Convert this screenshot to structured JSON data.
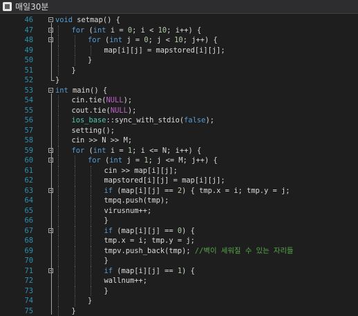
{
  "window": {
    "title": "매일30분",
    "icon": "app-icon"
  },
  "editor": {
    "lines": [
      {
        "n": "46",
        "fold": true,
        "indent": 0,
        "tokens": [
          {
            "t": "void",
            "c": "kw"
          },
          {
            "t": " setmap() {"
          }
        ]
      },
      {
        "n": "47",
        "fold": true,
        "indent": 1,
        "tokens": [
          {
            "t": "for",
            "c": "kw"
          },
          {
            "t": " ("
          },
          {
            "t": "int",
            "c": "kw"
          },
          {
            "t": " i = "
          },
          {
            "t": "0",
            "c": "num"
          },
          {
            "t": "; i < "
          },
          {
            "t": "10",
            "c": "num"
          },
          {
            "t": "; i++) {"
          }
        ]
      },
      {
        "n": "48",
        "fold": true,
        "indent": 2,
        "tokens": [
          {
            "t": "for",
            "c": "kw"
          },
          {
            "t": " ("
          },
          {
            "t": "int",
            "c": "kw"
          },
          {
            "t": " j = "
          },
          {
            "t": "0",
            "c": "num"
          },
          {
            "t": "; j < "
          },
          {
            "t": "10",
            "c": "num"
          },
          {
            "t": "; j++) {"
          }
        ]
      },
      {
        "n": "49",
        "fold": false,
        "indent": 3,
        "tokens": [
          {
            "t": "map[i][j] = mapstored[i][j];"
          }
        ]
      },
      {
        "n": "50",
        "fold": false,
        "indent": 2,
        "tokens": [
          {
            "t": "}"
          }
        ]
      },
      {
        "n": "51",
        "fold": false,
        "indent": 1,
        "tokens": [
          {
            "t": "}"
          }
        ]
      },
      {
        "n": "52",
        "fold": false,
        "indent": 0,
        "tokens": [
          {
            "t": "}"
          }
        ]
      },
      {
        "n": "53",
        "fold": true,
        "indent": 0,
        "tokens": [
          {
            "t": "int",
            "c": "kw"
          },
          {
            "t": " main() {"
          }
        ]
      },
      {
        "n": "54",
        "fold": false,
        "indent": 1,
        "tokens": [
          {
            "t": "cin.tie("
          },
          {
            "t": "NULL",
            "c": "macro"
          },
          {
            "t": ");"
          }
        ]
      },
      {
        "n": "55",
        "fold": false,
        "indent": 1,
        "tokens": [
          {
            "t": "cout.tie("
          },
          {
            "t": "NULL",
            "c": "macro"
          },
          {
            "t": ");"
          }
        ]
      },
      {
        "n": "56",
        "fold": false,
        "indent": 1,
        "tokens": [
          {
            "t": "ios_base",
            "c": "type"
          },
          {
            "t": "::sync_with_stdio("
          },
          {
            "t": "false",
            "c": "kw"
          },
          {
            "t": ");"
          }
        ]
      },
      {
        "n": "57",
        "fold": false,
        "indent": 1,
        "tokens": [
          {
            "t": "setting();"
          }
        ]
      },
      {
        "n": "58",
        "fold": false,
        "indent": 1,
        "tokens": [
          {
            "t": "cin >> N >> M;"
          }
        ]
      },
      {
        "n": "59",
        "fold": true,
        "indent": 1,
        "tokens": [
          {
            "t": "for",
            "c": "kw"
          },
          {
            "t": " ("
          },
          {
            "t": "int",
            "c": "kw"
          },
          {
            "t": " i = "
          },
          {
            "t": "1",
            "c": "num"
          },
          {
            "t": "; i <= N; i++) {"
          }
        ]
      },
      {
        "n": "60",
        "fold": true,
        "indent": 2,
        "tokens": [
          {
            "t": "for",
            "c": "kw"
          },
          {
            "t": " ("
          },
          {
            "t": "int",
            "c": "kw"
          },
          {
            "t": " j = "
          },
          {
            "t": "1",
            "c": "num"
          },
          {
            "t": "; j <= M; j++) {"
          }
        ]
      },
      {
        "n": "61",
        "fold": false,
        "indent": 3,
        "tokens": [
          {
            "t": "cin >> map[i][j];"
          }
        ]
      },
      {
        "n": "62",
        "fold": false,
        "indent": 3,
        "tokens": [
          {
            "t": "mapstored[i][j] = map[i][j];"
          }
        ]
      },
      {
        "n": "63",
        "fold": true,
        "indent": 3,
        "tokens": [
          {
            "t": "if",
            "c": "kw"
          },
          {
            "t": " (map[i][j] == "
          },
          {
            "t": "2",
            "c": "num"
          },
          {
            "t": ") { tmp.x = i; tmp.y = j;"
          }
        ]
      },
      {
        "n": "64",
        "fold": false,
        "indent": 3,
        "tokens": [
          {
            "t": "tmpq.push(tmp);"
          }
        ]
      },
      {
        "n": "65",
        "fold": false,
        "indent": 3,
        "tokens": [
          {
            "t": "virusnum++;"
          }
        ]
      },
      {
        "n": "66",
        "fold": false,
        "indent": 3,
        "tokens": [
          {
            "t": "}"
          }
        ]
      },
      {
        "n": "67",
        "fold": true,
        "indent": 3,
        "tokens": [
          {
            "t": "if",
            "c": "kw"
          },
          {
            "t": " (map[i][j] == "
          },
          {
            "t": "0",
            "c": "num"
          },
          {
            "t": ") {"
          }
        ]
      },
      {
        "n": "68",
        "fold": false,
        "indent": 3,
        "tokens": [
          {
            "t": "tmp.x = i; tmp.y = j;"
          }
        ]
      },
      {
        "n": "69",
        "fold": false,
        "indent": 3,
        "tokens": [
          {
            "t": "tmpv.push_back(tmp); "
          },
          {
            "t": "//벽이 세워질 수 있는 자리들",
            "c": "cmt"
          }
        ]
      },
      {
        "n": "70",
        "fold": false,
        "indent": 3,
        "tokens": [
          {
            "t": "}"
          }
        ]
      },
      {
        "n": "71",
        "fold": true,
        "indent": 3,
        "tokens": [
          {
            "t": "if",
            "c": "kw"
          },
          {
            "t": " (map[i][j] == "
          },
          {
            "t": "1",
            "c": "num"
          },
          {
            "t": ") {"
          }
        ]
      },
      {
        "n": "72",
        "fold": false,
        "indent": 3,
        "tokens": [
          {
            "t": "wallnum++;"
          }
        ]
      },
      {
        "n": "73",
        "fold": false,
        "indent": 3,
        "tokens": [
          {
            "t": "}"
          }
        ]
      },
      {
        "n": "74",
        "fold": false,
        "indent": 2,
        "tokens": [
          {
            "t": "}"
          }
        ]
      },
      {
        "n": "75",
        "fold": false,
        "indent": 1,
        "tokens": [
          {
            "t": "}"
          }
        ]
      }
    ]
  },
  "colors": {
    "background": "#1e1e1e",
    "line_number": "#2b91af",
    "keyword": "#569cd6",
    "number": "#b5cea8",
    "macro": "#bd63c5",
    "type": "#4ec9b0",
    "comment": "#57a64a",
    "text": "#dcdcdc"
  }
}
